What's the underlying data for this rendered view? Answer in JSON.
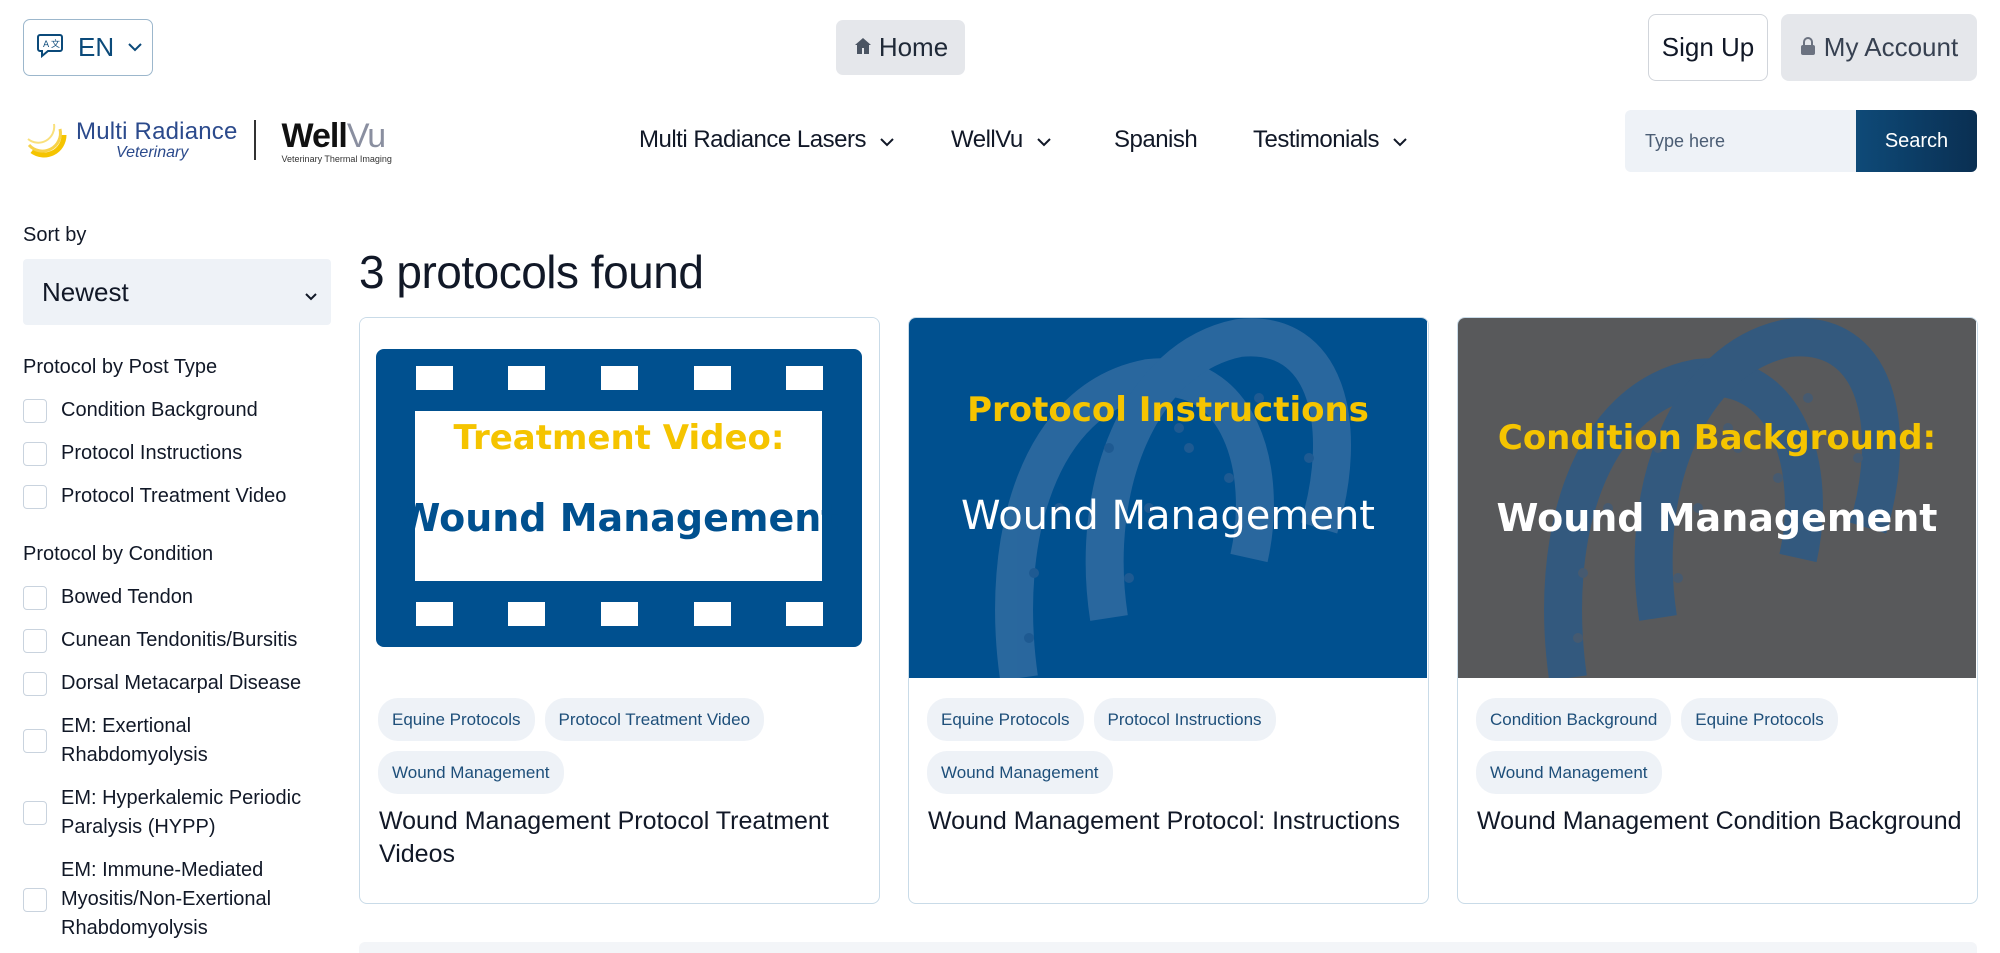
{
  "topbar": {
    "language": "EN",
    "home_label": "Home",
    "signup_label": "Sign Up",
    "account_label": "My Account"
  },
  "logo": {
    "brand_line1": "Multi Radiance",
    "brand_line2": "Veterinary",
    "wellvu_a": "Well",
    "wellvu_b": "Vu",
    "wellvu_sub": "Veterinary Thermal Imaging"
  },
  "nav": [
    {
      "label": "Multi Radiance Lasers",
      "has_dropdown": true
    },
    {
      "label": "WellVu",
      "has_dropdown": true
    },
    {
      "label": "Spanish",
      "has_dropdown": false
    },
    {
      "label": "Testimonials",
      "has_dropdown": true
    }
  ],
  "search": {
    "placeholder": "Type here",
    "button_label": "Search"
  },
  "sidebar": {
    "sort_label": "Sort by",
    "sort_value": "Newest",
    "post_type_title": "Protocol by Post Type",
    "post_types": [
      "Condition Background",
      "Protocol Instructions",
      "Protocol Treatment Video"
    ],
    "condition_title": "Protocol by Condition",
    "conditions": [
      "Bowed Tendon",
      "Cunean Tendonitis/Bursitis",
      "Dorsal Metacarpal Disease",
      "EM: Exertional Rhabdomyolysis",
      "EM: Hyperkalemic Periodic Paralysis (HYPP)",
      "EM: Immune-Mediated Myositis/Non-Exertional Rhabdomyolysis"
    ]
  },
  "results": {
    "title": "3 protocols found",
    "cards": [
      {
        "image_heading": "Treatment Video:",
        "image_subheading": "Wound Management",
        "tags": [
          "Equine Protocols",
          "Protocol Treatment Video",
          "Wound Management"
        ],
        "title": "Wound Management Protocol Treatment Videos"
      },
      {
        "image_heading": "Protocol Instructions",
        "image_subheading": "Wound Management",
        "tags": [
          "Equine Protocols",
          "Protocol Instructions",
          "Wound Management"
        ],
        "title": "Wound Management Protocol: Instructions"
      },
      {
        "image_heading": "Condition Background:",
        "image_subheading": "Wound Management",
        "tags": [
          "Condition Background",
          "Equine Protocols",
          "Wound Management"
        ],
        "title": "Wound Management Condition Background"
      }
    ]
  },
  "colors": {
    "brand_blue": "#00508f",
    "accent_yellow": "#f5c400",
    "card3_bg": "#58595b",
    "search_button": "#0b3a63"
  }
}
